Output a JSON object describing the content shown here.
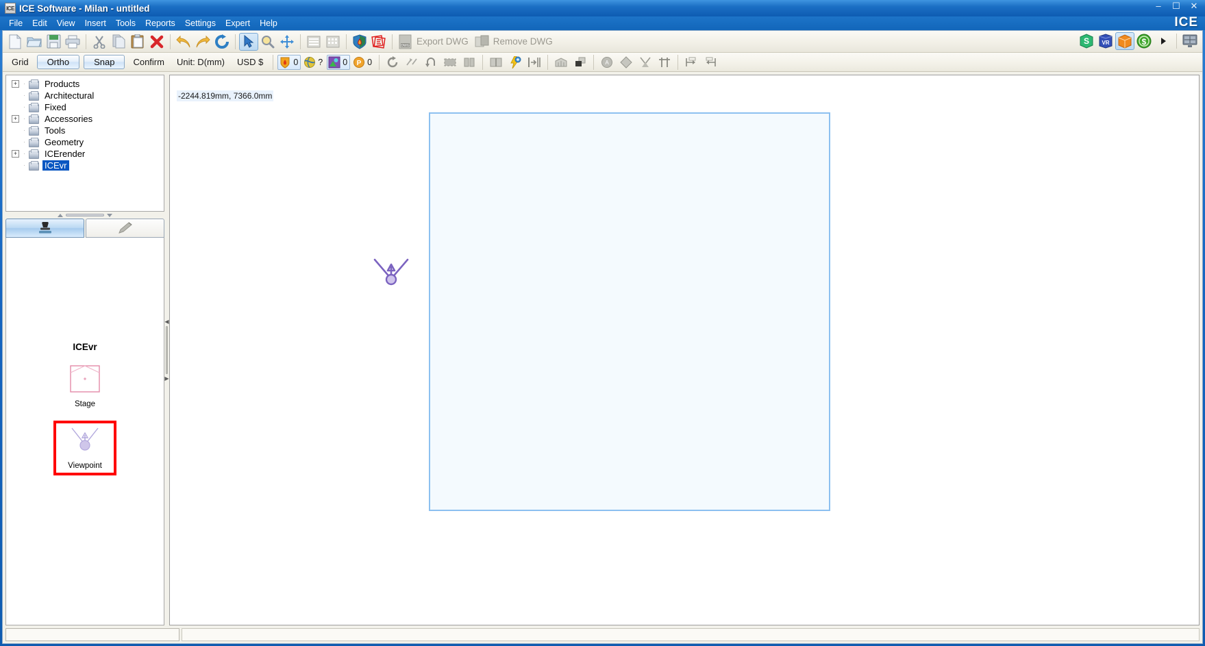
{
  "window": {
    "title": "ICE Software - Milan - untitled",
    "app_icon_label": "ICE",
    "brand": "ICE",
    "minimize": "–",
    "maximize": "☐",
    "close": "✕"
  },
  "menu": {
    "items": [
      {
        "label": "File"
      },
      {
        "label": "Edit"
      },
      {
        "label": "View"
      },
      {
        "label": "Insert"
      },
      {
        "label": "Tools"
      },
      {
        "label": "Reports"
      },
      {
        "label": "Settings"
      },
      {
        "label": "Expert"
      },
      {
        "label": "Help"
      }
    ]
  },
  "toolbar": {
    "buttons": [
      {
        "name": "new-file-icon",
        "kind": "icon"
      },
      {
        "name": "open-file-icon",
        "kind": "icon"
      },
      {
        "name": "save-icon",
        "kind": "icon"
      },
      {
        "name": "print-icon",
        "kind": "icon"
      },
      {
        "name": "cut-icon",
        "kind": "icon"
      },
      {
        "name": "copy-icon",
        "kind": "icon"
      },
      {
        "name": "paste-icon",
        "kind": "icon"
      },
      {
        "name": "delete-icon",
        "kind": "icon"
      },
      {
        "name": "undo-icon",
        "kind": "icon"
      },
      {
        "name": "redo-icon",
        "kind": "icon"
      },
      {
        "name": "refresh-icon",
        "kind": "icon"
      },
      {
        "name": "select-arrow-icon",
        "kind": "icon"
      },
      {
        "name": "zoom-icon",
        "kind": "icon"
      },
      {
        "name": "pan-icon",
        "kind": "icon"
      },
      {
        "name": "list-view-icon",
        "kind": "icon"
      },
      {
        "name": "grid-view-icon",
        "kind": "icon"
      },
      {
        "name": "shield-flame-icon",
        "kind": "icon"
      },
      {
        "name": "stamp-red-icon",
        "kind": "icon"
      }
    ],
    "export_dwg_label": "Export DWG",
    "remove_dwg_label": "Remove DWG",
    "right_icons": [
      {
        "name": "sketchup-icon",
        "glyph": "S"
      },
      {
        "name": "vr-icon",
        "glyph": "VR"
      },
      {
        "name": "render-box-icon",
        "glyph": ""
      },
      {
        "name": "price-dollar-icon",
        "glyph": "$"
      },
      {
        "name": "more-arrow-icon",
        "glyph": "▶"
      },
      {
        "name": "monitor-icon",
        "glyph": ""
      }
    ]
  },
  "optionbar": {
    "grid_label": "Grid",
    "ortho_label": "Ortho",
    "snap_label": "Snap",
    "confirm_label": "Confirm",
    "unit_label": "Unit: D(mm)",
    "currency_label": "USD $",
    "badges": [
      {
        "name": "fire-badge",
        "value": "0",
        "boxed": true,
        "color": "#f1a41e"
      },
      {
        "name": "globe-badge",
        "value": "?",
        "boxed": false,
        "color": "#e0c43a"
      },
      {
        "name": "layer-badge",
        "value": "0",
        "boxed": true,
        "color": "#7f4fb5"
      },
      {
        "name": "parking-badge",
        "value": "0",
        "boxed": false,
        "color": "#f0a32a"
      }
    ],
    "tool_icons": [
      {
        "name": "rotate-icon"
      },
      {
        "name": "mirror-icon"
      },
      {
        "name": "undo-arc-icon"
      },
      {
        "name": "align-horizontal-icon"
      },
      {
        "name": "align-vertical-icon"
      },
      {
        "name": "book-icon"
      },
      {
        "name": "lightning-icon"
      },
      {
        "name": "distribute-icon"
      },
      {
        "name": "stairs-icon"
      },
      {
        "name": "extrude-icon"
      },
      {
        "name": "area-icon"
      },
      {
        "name": "diamond-icon"
      },
      {
        "name": "cone-icon"
      },
      {
        "name": "fence-icon"
      },
      {
        "name": "dim-left-icon"
      },
      {
        "name": "dim-right-icon"
      }
    ]
  },
  "sidebar": {
    "tree": [
      {
        "label": "Products",
        "expandable": true,
        "expander": "+",
        "selected": false
      },
      {
        "label": "Architectural",
        "expandable": false,
        "expander": "",
        "selected": false
      },
      {
        "label": "Fixed",
        "expandable": false,
        "expander": "",
        "selected": false
      },
      {
        "label": "Accessories",
        "expandable": true,
        "expander": "+",
        "selected": false
      },
      {
        "label": "Tools",
        "expandable": false,
        "expander": "",
        "selected": false
      },
      {
        "label": "Geometry",
        "expandable": false,
        "expander": "",
        "selected": false
      },
      {
        "label": "ICErender",
        "expandable": true,
        "expander": "+",
        "selected": false
      },
      {
        "label": "ICEvr",
        "expandable": false,
        "expander": "",
        "selected": true
      }
    ],
    "tabs": [
      {
        "name": "tab-stamp",
        "icon": "stamp-icon",
        "active": true
      },
      {
        "name": "tab-pencil",
        "icon": "pencil-icon",
        "active": false
      }
    ],
    "library": {
      "group_title": "ICEvr",
      "items": [
        {
          "label": "Stage",
          "icon": "stage-icon",
          "selected": false
        },
        {
          "label": "Viewpoint",
          "icon": "viewpoint-icon",
          "selected": true
        }
      ]
    }
  },
  "canvas": {
    "coordinates": "-2244.819mm, 7366.0mm",
    "plot_fill": "#f4fafe",
    "plot_border": "#8cc0f0",
    "marker": {
      "name": "viewpoint-marker",
      "color": "#7b63c0"
    }
  }
}
